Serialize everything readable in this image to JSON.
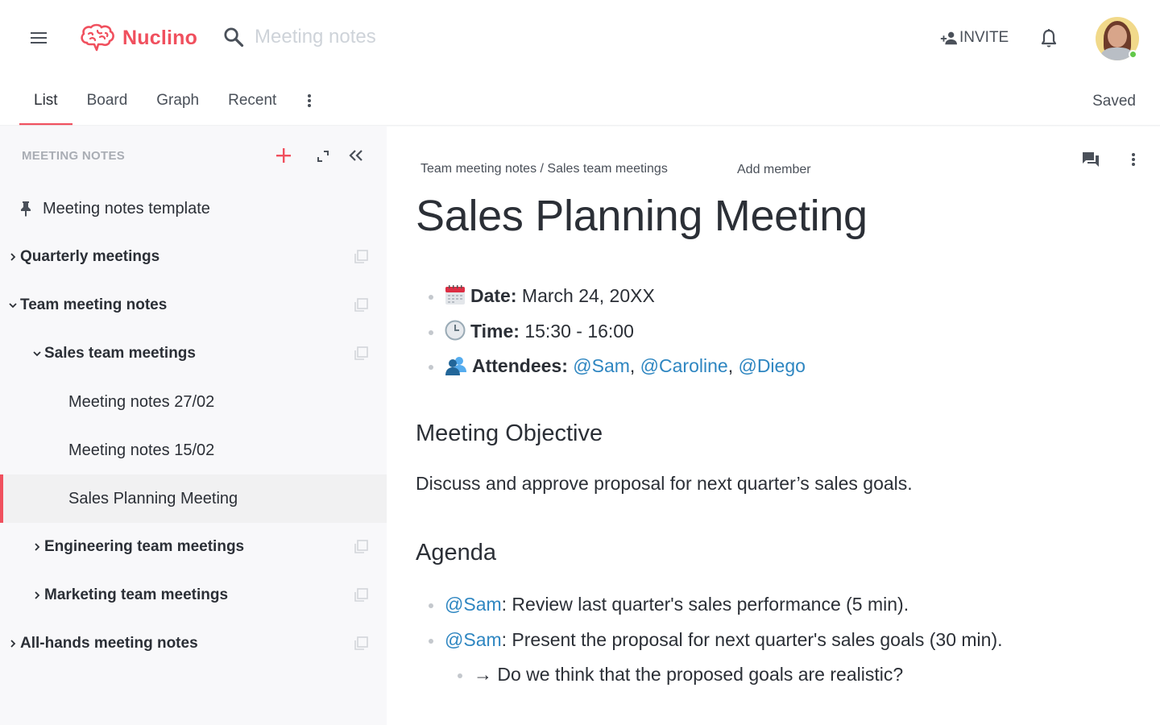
{
  "header": {
    "app_name": "Nuclino",
    "search_placeholder": "Meeting notes",
    "invite_label": "INVITE",
    "user_status": "online"
  },
  "tabs": [
    {
      "label": "List",
      "active": true
    },
    {
      "label": "Board",
      "active": false
    },
    {
      "label": "Graph",
      "active": false
    },
    {
      "label": "Recent",
      "active": false
    }
  ],
  "save_status": "Saved",
  "sidebar": {
    "title": "MEETING NOTES",
    "items": [
      {
        "label": "Meeting notes template",
        "icon": "pin-icon",
        "level": 0,
        "bold": false
      },
      {
        "label": "Quarterly meetings",
        "icon": "chevron-right-icon",
        "level": 0,
        "bold": true
      },
      {
        "label": "Team meeting notes",
        "icon": "chevron-down-icon",
        "level": 0,
        "bold": true
      },
      {
        "label": "Sales team meetings",
        "icon": "chevron-down-icon",
        "level": 1,
        "bold": true
      },
      {
        "label": "Meeting notes 27/02",
        "icon": "",
        "level": 2,
        "bold": false
      },
      {
        "label": "Meeting notes 15/02",
        "icon": "",
        "level": 2,
        "bold": false
      },
      {
        "label": "Sales Planning Meeting",
        "icon": "",
        "level": 2,
        "bold": false,
        "selected": true
      },
      {
        "label": "Engineering team meetings",
        "icon": "chevron-right-icon",
        "level": 1,
        "bold": true
      },
      {
        "label": "Marketing team meetings",
        "icon": "chevron-right-icon",
        "level": 1,
        "bold": true
      },
      {
        "label": "All-hands meeting notes",
        "icon": "chevron-right-icon",
        "level": 0,
        "bold": true
      }
    ]
  },
  "document": {
    "breadcrumb": [
      "Team meeting notes",
      "Sales team meetings"
    ],
    "breadcrumb_separator": " / ",
    "add_member_label": "Add member",
    "title": "Sales Planning Meeting",
    "details": {
      "date_label": "Date:",
      "date_value": "March 24, 20XX",
      "time_label": "Time:",
      "time_value": "15:30 - 16:00",
      "attendees_label": "Attendees:",
      "attendees": [
        "@Sam",
        "@Caroline",
        "@Diego"
      ]
    },
    "objective_heading": "Meeting Objective",
    "objective_text": "Discuss and approve proposal for next quarter’s sales goals.",
    "agenda_heading": "Agenda",
    "agenda": [
      {
        "mention": "@Sam",
        "text": ": Review last quarter's sales performance (5 min)."
      },
      {
        "mention": "@Sam",
        "text": ": Present the proposal for next quarter's sales goals (30 min)."
      }
    ],
    "agenda_sub": "→ Do we think that the proposed goals are realistic?"
  },
  "colors": {
    "brand": "#f0505e",
    "mention": "#2e86c1",
    "text": "#2b2f36",
    "muted": "#a9adb4"
  }
}
